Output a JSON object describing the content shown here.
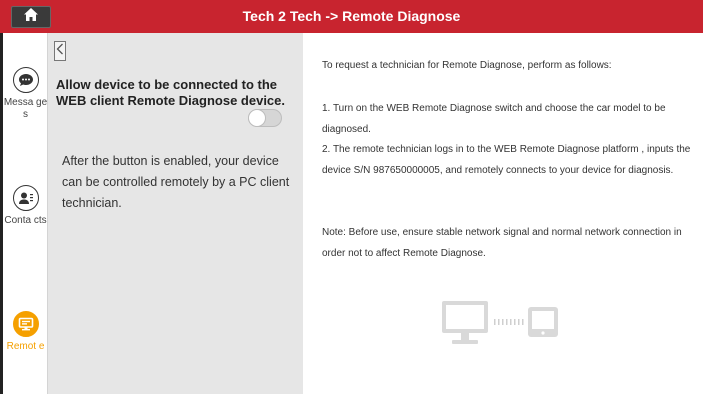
{
  "title": "Tech 2 Tech -> Remote Diagnose",
  "sidebar": {
    "items": [
      {
        "label": "Messa ges",
        "icon": "chat-bubble-icon"
      },
      {
        "label": "Conta cts",
        "icon": "contact-card-icon"
      },
      {
        "label": "Remot e",
        "icon": "remote-desktop-icon"
      }
    ]
  },
  "panel": {
    "heading": "Allow device to be connected to the WEB client Remote Diagnose device.",
    "description": "After the button is enabled, your device can be controlled remotely by a PC client technician.",
    "toggle_state": "off"
  },
  "content": {
    "intro": "To request a technician for Remote Diagnose, perform as follows:",
    "step1": "1. Turn on the WEB Remote Diagnose switch and choose the car model to be diagnosed.",
    "step2": "2. The remote technician logs in to the WEB Remote Diagnose platform , inputs the device S/N 987650000005, and remotely connects to your device for diagnosis.",
    "note": "Note: Before use, ensure stable network signal and normal network connection in order not to affect Remote Diagnose."
  },
  "colors": {
    "titlebar": "#c8242f",
    "accent": "#f5a000",
    "panel_bg": "#e6e6e6"
  }
}
